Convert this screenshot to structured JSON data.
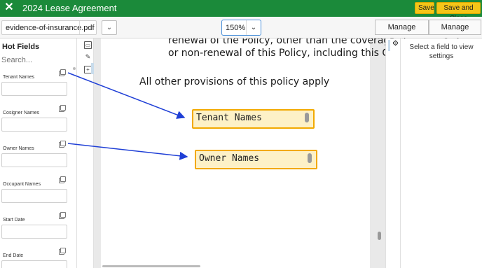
{
  "titlebar": {
    "title": "2024 Lease Agreement",
    "close_icon": "close-icon",
    "save_label": "Save",
    "save_close_label": "Save and Close",
    "bg_color": "#1b8a3a",
    "button_color": "#f5c518"
  },
  "toolbar": {
    "file_name": "evidence-of-insurance.pdf",
    "zoom": "150%",
    "manage_parties_label": "Manage Parties",
    "manage_copies_label": "Manage Copies"
  },
  "left_panel": {
    "title": "Hot Fields",
    "search_placeholder": "Search...",
    "fields": [
      {
        "label": "Tenant Names",
        "value": ""
      },
      {
        "label": "Cosigner Names",
        "value": ""
      },
      {
        "label": "Owner Names",
        "value": ""
      },
      {
        "label": "Occupant Names",
        "value": ""
      },
      {
        "label": "Start Date",
        "value": ""
      },
      {
        "label": "End Date",
        "value": ""
      }
    ]
  },
  "tools": [
    "select-icon",
    "pen-icon",
    "add-field-icon"
  ],
  "document": {
    "line1": "renewal of the Policy, other than the coverag",
    "line2": "or non-renewal of this Policy, including this C",
    "line3": "All other provisions of this policy apply",
    "field_tenant": "Tenant Names",
    "field_owner": "Owner Names",
    "field_highlight_color": "#fdf1c7",
    "field_border_color": "#f2a900",
    "arrow_color": "#1f3fd6"
  },
  "settings": {
    "gear_icon": "gear-icon",
    "message": "Select a field to view settings"
  }
}
